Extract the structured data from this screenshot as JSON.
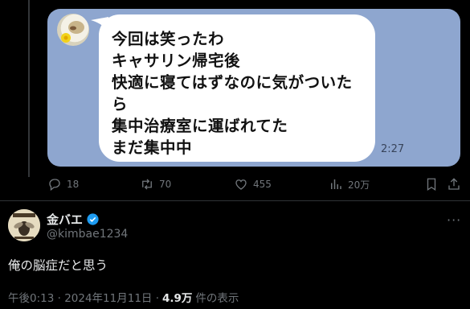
{
  "quoted_chat": {
    "message_lines": "今回は笑ったわ\nキャサリン帰宅後\n快適に寝てはずなのに気がついた\nら\n集中治療室に運ばれてた\nまだ集中中",
    "time": "2:27",
    "background_color": "#8ea6cf"
  },
  "actions": {
    "reply_count": "18",
    "retweet_count": "70",
    "like_count": "455",
    "views_count": "20万",
    "icons": [
      "reply-icon",
      "retweet-icon",
      "like-icon",
      "views-icon",
      "bookmark-icon",
      "share-icon"
    ]
  },
  "post": {
    "author_name": "金バエ",
    "author_handle": "@kimbae1234",
    "text": "俺の脳症だと思う",
    "timestamp": "午後0:13 · 2024年11月11日 ·",
    "views_count": "4.9万",
    "views_label": "件の表示",
    "verified_color": "#1d9bf0"
  }
}
